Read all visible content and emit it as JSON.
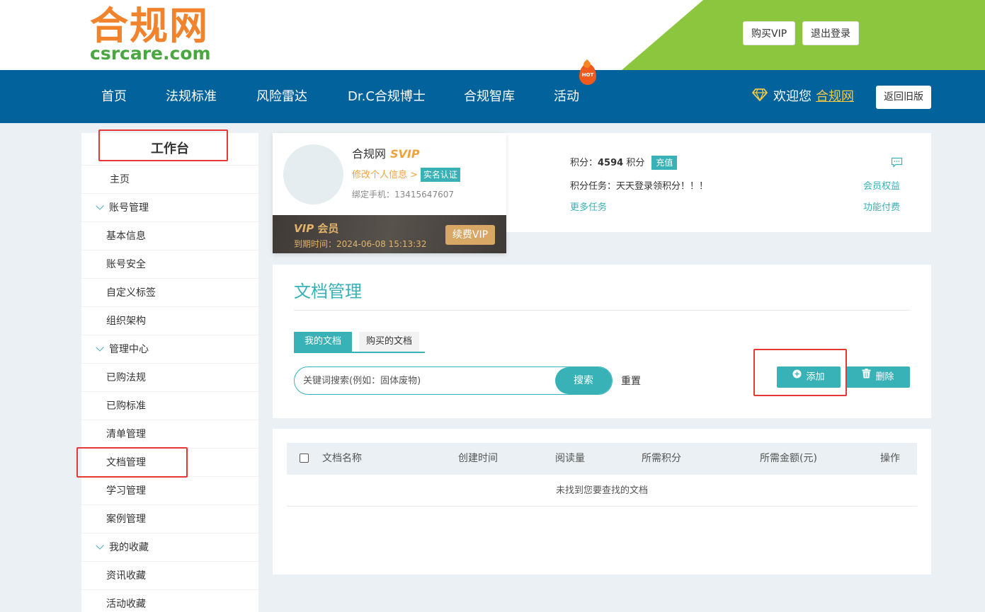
{
  "header": {
    "logo_cn": "合规网",
    "logo_en": "csrcare.com",
    "buy_vip": "购买VIP",
    "logout": "退出登录"
  },
  "nav": {
    "items": [
      "首页",
      "法规标准",
      "风险雷达",
      "Dr.C合规博士",
      "合规智库",
      "活动"
    ],
    "hot_badge": "HOT",
    "welcome": "欢迎您",
    "username": "合规网",
    "old_version": "返回旧版"
  },
  "sidebar": {
    "title": "工作台",
    "home": "主页",
    "groups": {
      "account": "账号管理",
      "manage": "管理中心",
      "favorites": "我的收藏"
    },
    "account_items": [
      "基本信息",
      "账号安全",
      "自定义标签",
      "组织架构"
    ],
    "manage_items": [
      "已购法规",
      "已购标准",
      "清单管理",
      "文档管理",
      "学习管理",
      "案例管理"
    ],
    "favorite_items": [
      "资讯收藏",
      "活动收藏"
    ]
  },
  "profile": {
    "name": "合规网",
    "level": "SVIP",
    "edit": "修改个人信息",
    "arrow": ">",
    "verify": "实名认证",
    "phone": "绑定手机：13415647607",
    "vip_title_prefix": "VIP",
    "vip_title_suffix": "会员",
    "expire": "到期时间：2024-06-08 15:13:32",
    "renew": "续费VIP",
    "points_label": "积分：",
    "points_value": "4594",
    "points_unit": "积分",
    "charge": "充值",
    "task": "积分任务：天天登录领积分！！！",
    "more_tasks": "更多任务",
    "member_rights": "会员权益",
    "paid_features": "功能付费"
  },
  "docs": {
    "title": "文档管理",
    "tab_mine": "我的文档",
    "tab_bought": "购买的文档",
    "search_placeholder": "关键词搜索(例如：固体废物)",
    "search_button": "搜索",
    "reset": "重置",
    "add": "添加",
    "delete": "删除"
  },
  "table": {
    "columns": [
      "文档名称",
      "创建时间",
      "阅读量",
      "所需积分",
      "所需金额(元)",
      "操作"
    ],
    "empty": "未找到您要查找的文档"
  },
  "colors": {
    "nav_bg": "#01629c",
    "accent": "#38b2b7",
    "logo_orange": "#f0832c",
    "logo_green": "#49a73f",
    "header_green": "#8cc63f",
    "annotation_red": "#e53935"
  }
}
